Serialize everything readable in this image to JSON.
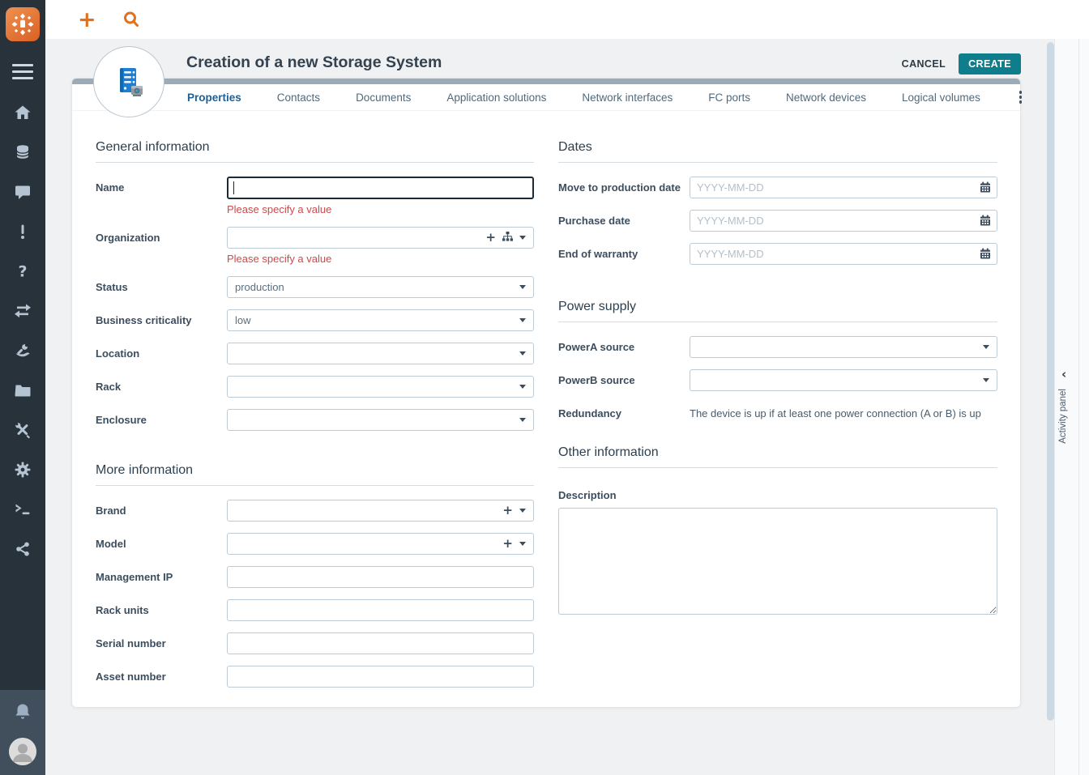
{
  "colors": {
    "accent_orange": "#e2711d",
    "create_teal": "#0e7d8c",
    "error_red": "#cc4b4b",
    "active_tab_blue": "#1e5f95",
    "sidebar_dark": "#27323b"
  },
  "icons": {
    "plus": "+",
    "chevron_left": "‹"
  },
  "topbar": {
    "actions": [
      "new-object",
      "search"
    ]
  },
  "sidebar": {
    "items": [
      "menu",
      "home",
      "database",
      "chat",
      "exclamation",
      "question",
      "transfer",
      "hand-tool",
      "folder",
      "tools",
      "gear",
      "terminal",
      "share"
    ],
    "bottom": [
      "bell",
      "avatar"
    ]
  },
  "header": {
    "title": "Creation of a new Storage System",
    "cancel_label": "CANCEL",
    "create_label": "CREATE"
  },
  "tabs": {
    "items": [
      {
        "label": "Properties",
        "active": true
      },
      {
        "label": "Contacts",
        "active": false
      },
      {
        "label": "Documents",
        "active": false
      },
      {
        "label": "Application solutions",
        "active": false
      },
      {
        "label": "Network interfaces",
        "active": false
      },
      {
        "label": "FC ports",
        "active": false
      },
      {
        "label": "Network devices",
        "active": false
      },
      {
        "label": "Logical volumes",
        "active": false
      }
    ]
  },
  "form": {
    "general": {
      "title": "General information",
      "name": {
        "label": "Name",
        "value": "",
        "error": "Please specify a value"
      },
      "organization": {
        "label": "Organization",
        "value": "",
        "error": "Please specify a value"
      },
      "status": {
        "label": "Status",
        "value": "production"
      },
      "business_criticality": {
        "label": "Business criticality",
        "value": "low"
      },
      "location": {
        "label": "Location",
        "value": ""
      },
      "rack": {
        "label": "Rack",
        "value": ""
      },
      "enclosure": {
        "label": "Enclosure",
        "value": ""
      }
    },
    "more": {
      "title": "More information",
      "brand": {
        "label": "Brand",
        "value": ""
      },
      "model": {
        "label": "Model",
        "value": ""
      },
      "management_ip": {
        "label": "Management IP",
        "value": ""
      },
      "rack_units": {
        "label": "Rack units",
        "value": ""
      },
      "serial_number": {
        "label": "Serial number",
        "value": ""
      },
      "asset_number": {
        "label": "Asset number",
        "value": ""
      }
    },
    "dates": {
      "title": "Dates",
      "move_to_production": {
        "label": "Move to production date",
        "value": "",
        "placeholder": "YYYY-MM-DD"
      },
      "purchase": {
        "label": "Purchase date",
        "value": "",
        "placeholder": "YYYY-MM-DD"
      },
      "end_of_warranty": {
        "label": "End of warranty",
        "value": "",
        "placeholder": "YYYY-MM-DD"
      }
    },
    "power": {
      "title": "Power supply",
      "power_a": {
        "label": "PowerA source",
        "value": ""
      },
      "power_b": {
        "label": "PowerB source",
        "value": ""
      },
      "redundancy": {
        "label": "Redundancy",
        "value": "The device is up if at least one power connection (A or B) is up"
      }
    },
    "other": {
      "title": "Other information",
      "description": {
        "label": "Description",
        "value": ""
      }
    }
  },
  "activity_panel": {
    "label": "Activity panel"
  }
}
